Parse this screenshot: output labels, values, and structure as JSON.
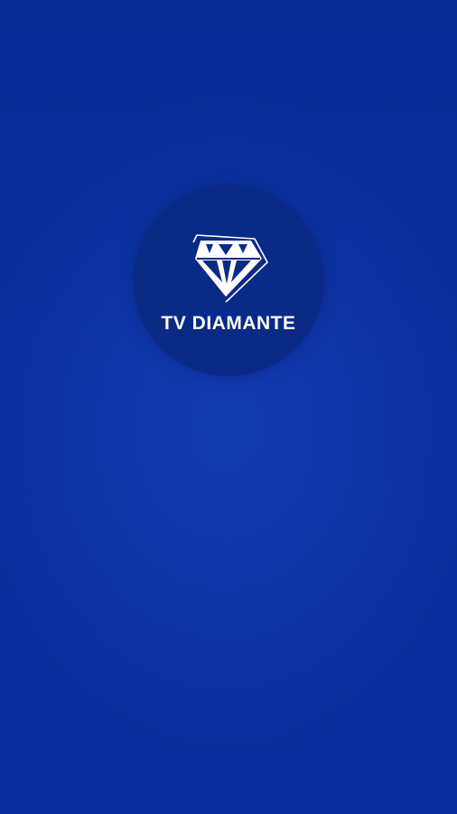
{
  "app": {
    "brand_name": "TV DIAMANTE",
    "logo_icon": "diamond-icon"
  },
  "colors": {
    "background": "#0a2f9a",
    "logo_circle": "#0a2a88",
    "logo_foreground": "#ffffff"
  }
}
